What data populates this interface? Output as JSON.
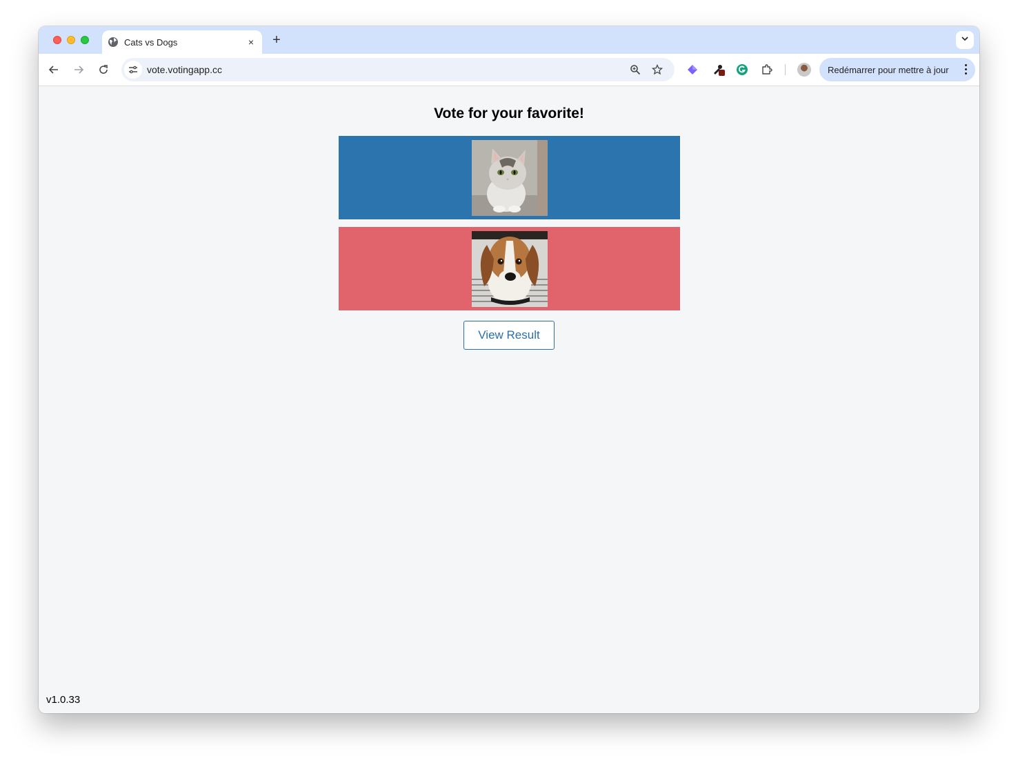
{
  "browser": {
    "tab": {
      "title": "Cats vs Dogs",
      "favicon": "globe-icon",
      "close": "×"
    },
    "new_tab": "+",
    "address_bar": {
      "url": "vote.votingapp.cc"
    },
    "update_button": {
      "label": "Redémarrer pour mettre à jour"
    }
  },
  "page": {
    "title": "Vote for your favorite!",
    "options": [
      {
        "name": "cats",
        "color": "#2c74ae",
        "image": "cat-photo"
      },
      {
        "name": "dogs",
        "color": "#e1646c",
        "image": "dog-photo"
      }
    ],
    "view_result_label": "View Result",
    "version": "v1.0.33"
  }
}
